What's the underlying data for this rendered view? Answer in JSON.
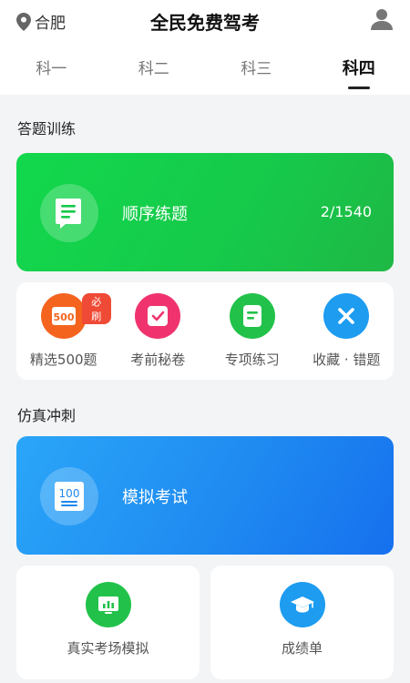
{
  "header": {
    "location": "合肥",
    "title": "全民免费驾考"
  },
  "tabs": [
    {
      "label": "科一"
    },
    {
      "label": "科二"
    },
    {
      "label": "科三"
    },
    {
      "label": "科四",
      "active": true
    }
  ],
  "practice": {
    "section_title": "答题训练",
    "main_card": {
      "label": "顺序练题",
      "progress": "2/1540"
    },
    "shortcuts": [
      {
        "label": "精选500题",
        "badge": "必刷",
        "icon_text": "500",
        "icon": "500-questions-icon"
      },
      {
        "label": "考前秘卷",
        "icon": "exam-paper-icon"
      },
      {
        "label": "专项练习",
        "icon": "special-practice-icon"
      },
      {
        "label": "收藏 · 错题",
        "icon": "favorites-mistakes-icon"
      }
    ]
  },
  "simulation": {
    "section_title": "仿真冲刺",
    "main_card": {
      "label": "模拟考试",
      "icon_text": "100"
    },
    "cards": [
      {
        "label": "真实考场模拟",
        "icon": "real-exam-room-icon"
      },
      {
        "label": "成绩单",
        "icon": "transcript-graduation-cap-icon"
      }
    ]
  },
  "colors": {
    "green_card": "#16c94a",
    "blue_card": "#1e88f0",
    "orange_icon": "#f4641f",
    "pink_icon": "#f0336e",
    "green_icon": "#22c24a",
    "blue_icon": "#1d9cf0",
    "badge_red": "#ef4a35"
  }
}
